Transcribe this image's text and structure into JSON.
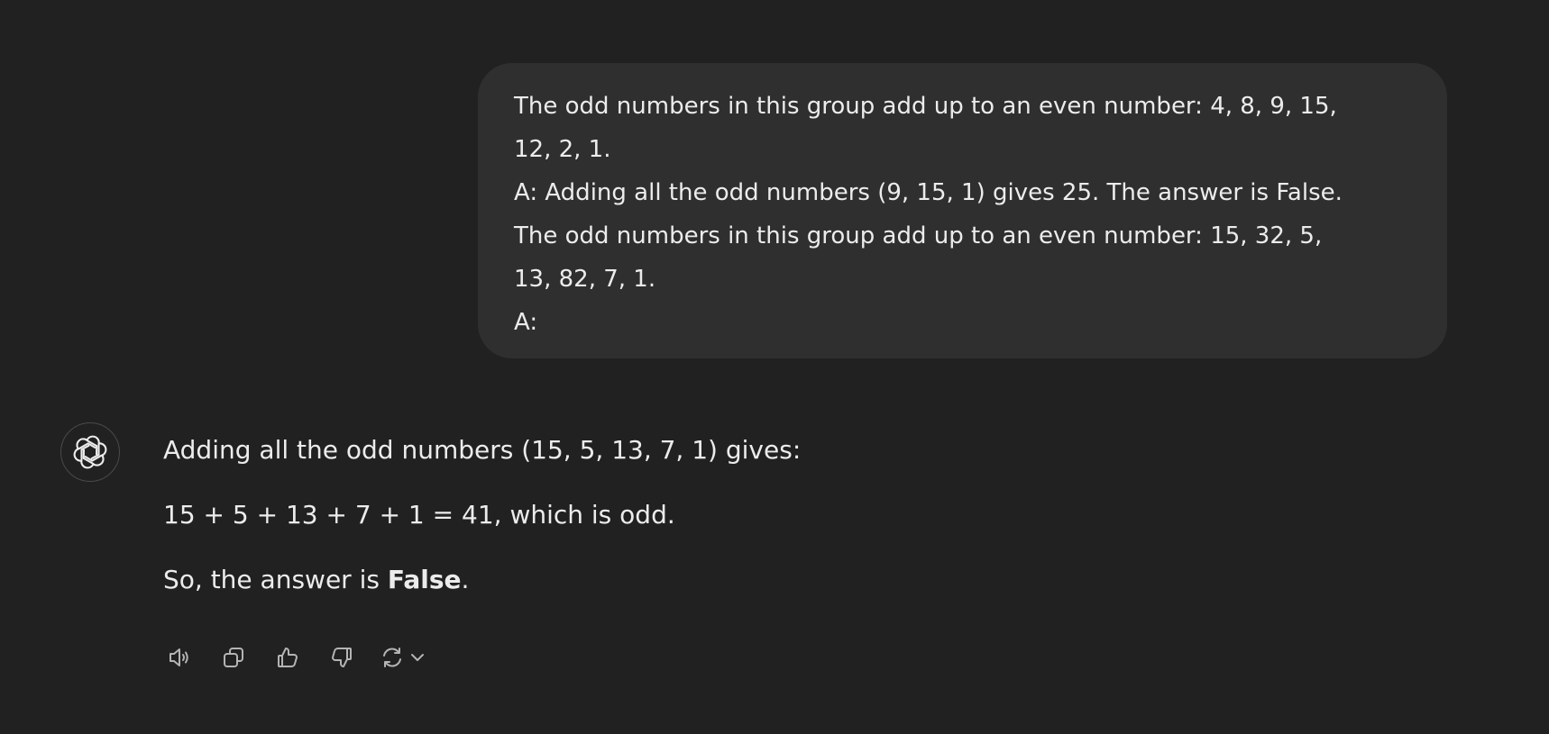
{
  "user_message": {
    "lines": [
      "The odd numbers in this group add up to an even number: 4, 8, 9, 15,",
      "12, 2, 1.",
      "A: Adding all the odd numbers (9, 15, 1) gives 25. The answer is False.",
      "The odd numbers in this group add up to an even number: 15, 32, 5,",
      "13, 82, 7, 1.",
      "A:"
    ]
  },
  "assistant_message": {
    "avatar_icon": "openai-logo-icon",
    "paragraph_1": "Adding all the odd numbers (15, 5, 13, 7, 1) gives:",
    "paragraph_2": "15 + 5 + 13 + 7 + 1 = 41, which is odd.",
    "paragraph_3_prefix": "So, the answer is ",
    "paragraph_3_bold": "False",
    "paragraph_3_suffix": "."
  },
  "actions": {
    "icons": [
      "speaker-icon",
      "copy-icon",
      "thumbs-up-icon",
      "thumbs-down-icon",
      "regenerate-icon",
      "chevron-down-icon"
    ]
  },
  "colors": {
    "background": "#212121",
    "bubble": "#2f2f2f",
    "text": "#ececec",
    "icon": "#b4b4b4"
  }
}
